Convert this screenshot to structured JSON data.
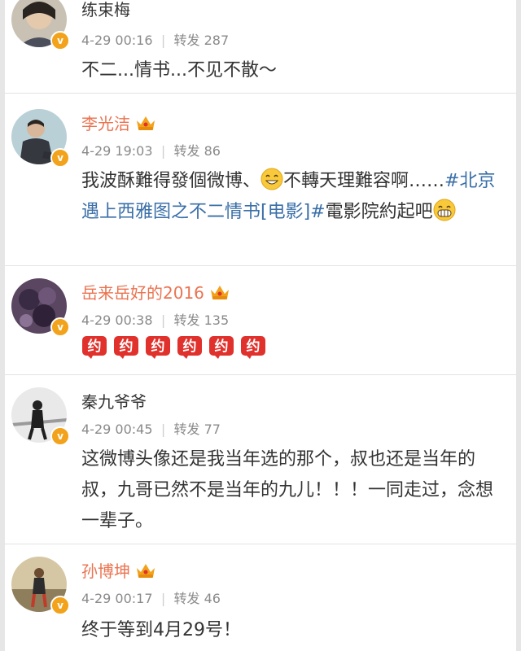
{
  "comments": [
    {
      "name": "练束梅",
      "vip": false,
      "time": "4-29 00:16",
      "repost": "转发 287",
      "text": "不二...情书...不见不散～"
    },
    {
      "name": "李光洁",
      "vip": true,
      "time": "4-29 19:03",
      "repost": "转发 86",
      "text_part1": "我波酥難得發個微博、",
      "text_part2": "不轉天理難容啊……",
      "hashtag": "#北京遇上西雅图之不二情书[电影]#",
      "text_part3": "電影院約起吧"
    },
    {
      "name": "岳来岳好的2016",
      "vip": true,
      "time": "4-29 00:38",
      "repost": "转发 135",
      "gift_count": 6,
      "gift_glyph": "约"
    },
    {
      "name": "秦九爷爷",
      "vip": false,
      "time": "4-29 00:45",
      "repost": "转发 77",
      "text": "这微博头像还是我当年选的那个，叔也还是当年的叔，九哥已然不是当年的九儿！！！一同走过，念想一辈子。"
    },
    {
      "name": "孙博坤",
      "vip": true,
      "time": "4-29 00:17",
      "repost": "转发 46",
      "text": "终于等到4月29号！"
    }
  ],
  "ui": {
    "separator": "|",
    "verified_badge": "v",
    "emoji_icons": [
      "grin-emoji-icon",
      "big-smile-emoji-icon"
    ],
    "crown_icon": "vip-crown-icon"
  },
  "colors": {
    "vip_name": "#eb7350",
    "hashtag": "#3a6fa8",
    "badge": "#f2a21b",
    "gift": "#e0312c"
  }
}
